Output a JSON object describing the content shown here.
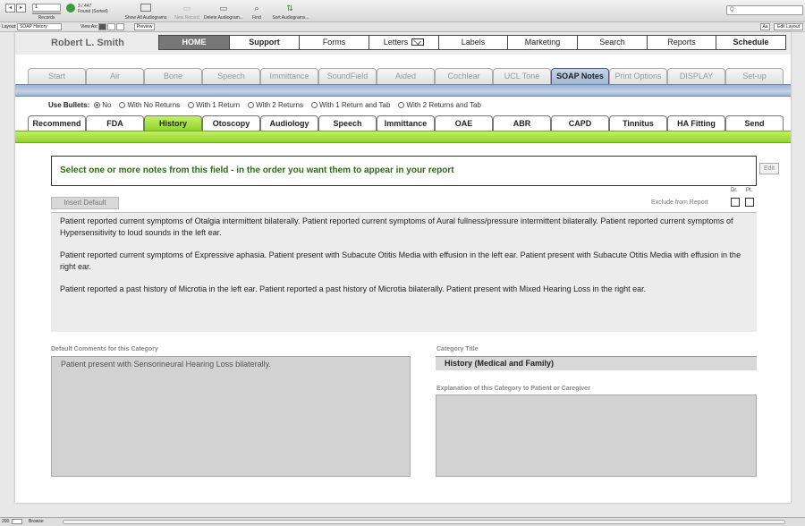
{
  "toolbar": {
    "nav_prev": "◂",
    "nav_next": "▸",
    "record_value": "1",
    "records_label": "Records",
    "found_count": "3 / 447",
    "found_status": "Found (Sorted)",
    "show_all": "Show All Audiograms",
    "new_record": "New Record",
    "delete": "Delete Audiogram...",
    "find": "Find",
    "sort": "Sort Audiograms...",
    "search_placeholder": "Q"
  },
  "layoutbar": {
    "layout_label": "Layout:",
    "layout_value": "SOAP History",
    "view_as": "View As:",
    "preview": "Preview",
    "aa": "Aa",
    "edit_layout": "Edit Layout"
  },
  "patient_name": "Robert L. Smith",
  "main_nav": [
    {
      "label": "HOME",
      "style": "home"
    },
    {
      "label": "Support",
      "style": "bold"
    },
    {
      "label": "Forms",
      "style": ""
    },
    {
      "label": "Letters",
      "style": "mail"
    },
    {
      "label": "Labels",
      "style": ""
    },
    {
      "label": "Marketing",
      "style": ""
    },
    {
      "label": "Search",
      "style": ""
    },
    {
      "label": "Reports",
      "style": ""
    },
    {
      "label": "Schedule",
      "style": "bold"
    }
  ],
  "test_tabs": [
    "Start",
    "Air",
    "Bone",
    "Speech",
    "Immittance",
    "SoundField",
    "Aided",
    "Cochlear",
    "UCL Tone",
    "SOAP Notes",
    "Print Options",
    "DISPLAY",
    "Set-up"
  ],
  "test_tabs_active": "SOAP Notes",
  "bullets": {
    "label": "Use Bullets:",
    "options": [
      "No",
      "With No Returns",
      "With 1 Return",
      "With 2 Returns",
      "With 1 Return and Tab",
      "With 2 Returns and Tab"
    ],
    "selected": "No"
  },
  "soap_tabs": [
    "Recommend",
    "FDA",
    "History",
    "Otoscopy",
    "Audiology",
    "Speech",
    "Immittance",
    "OAE",
    "ABR",
    "CAPD",
    "Tinnitus",
    "HA Fitting",
    "Send"
  ],
  "soap_tabs_active": "History",
  "instruction": "Select one or more notes from this field -  in the order you want them to appear in your report",
  "edit_button": "Edit",
  "insert_default": "Insert Default",
  "exclude_label": "Exclude from Report",
  "dr_label": "Dr.",
  "pt_label": "Pt.",
  "notes": [
    "Patient reported current symptoms of Otalgia intermittent bilaterally. Patient reported current symptoms of Aural fullness/pressure intermittent bilaterally. Patient reported current symptoms of Hypersensitivity to loud sounds in the left ear.",
    " Patient reported current symptoms of Expressive aphasia. Patient present with Subacute Otitis Media with effusion in the left ear. Patient present with Subacute Otitis Media with effusion in the right ear.",
    " Patient reported a past history of Microtia in the left ear. Patient reported a past history of Microtia bilaterally. Patient present with Mixed Hearing Loss in the right ear."
  ],
  "default_comments_label": "Default Comments for this Category",
  "default_comments": "Patient present with Sensorineural Hearing Loss bilaterally.",
  "category_title_label": "Category Title",
  "category_title": "History (Medical and Family)",
  "explanation_label": "Explanation of this Category to Patient or Caregiver",
  "explanation": "",
  "status": {
    "zoom": "200",
    "mode": "Browse"
  },
  "colors": {
    "blue_bar": "#9bb2d2",
    "green_bar": "#8fd22c",
    "instruction_text": "#2d6b12",
    "home_bg": "#777777"
  }
}
